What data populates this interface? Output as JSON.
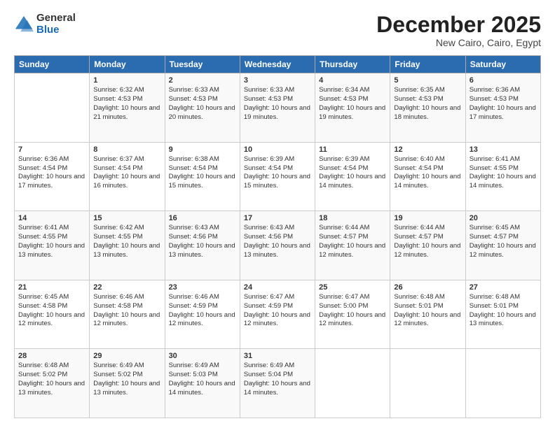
{
  "logo": {
    "general": "General",
    "blue": "Blue"
  },
  "header": {
    "title": "December 2025",
    "subtitle": "New Cairo, Cairo, Egypt"
  },
  "weekdays": [
    "Sunday",
    "Monday",
    "Tuesday",
    "Wednesday",
    "Thursday",
    "Friday",
    "Saturday"
  ],
  "weeks": [
    [
      {
        "day": "",
        "sunrise": "",
        "sunset": "",
        "daylight": ""
      },
      {
        "day": "1",
        "sunrise": "Sunrise: 6:32 AM",
        "sunset": "Sunset: 4:53 PM",
        "daylight": "Daylight: 10 hours and 21 minutes."
      },
      {
        "day": "2",
        "sunrise": "Sunrise: 6:33 AM",
        "sunset": "Sunset: 4:53 PM",
        "daylight": "Daylight: 10 hours and 20 minutes."
      },
      {
        "day": "3",
        "sunrise": "Sunrise: 6:33 AM",
        "sunset": "Sunset: 4:53 PM",
        "daylight": "Daylight: 10 hours and 19 minutes."
      },
      {
        "day": "4",
        "sunrise": "Sunrise: 6:34 AM",
        "sunset": "Sunset: 4:53 PM",
        "daylight": "Daylight: 10 hours and 19 minutes."
      },
      {
        "day": "5",
        "sunrise": "Sunrise: 6:35 AM",
        "sunset": "Sunset: 4:53 PM",
        "daylight": "Daylight: 10 hours and 18 minutes."
      },
      {
        "day": "6",
        "sunrise": "Sunrise: 6:36 AM",
        "sunset": "Sunset: 4:53 PM",
        "daylight": "Daylight: 10 hours and 17 minutes."
      }
    ],
    [
      {
        "day": "7",
        "sunrise": "Sunrise: 6:36 AM",
        "sunset": "Sunset: 4:54 PM",
        "daylight": "Daylight: 10 hours and 17 minutes."
      },
      {
        "day": "8",
        "sunrise": "Sunrise: 6:37 AM",
        "sunset": "Sunset: 4:54 PM",
        "daylight": "Daylight: 10 hours and 16 minutes."
      },
      {
        "day": "9",
        "sunrise": "Sunrise: 6:38 AM",
        "sunset": "Sunset: 4:54 PM",
        "daylight": "Daylight: 10 hours and 15 minutes."
      },
      {
        "day": "10",
        "sunrise": "Sunrise: 6:39 AM",
        "sunset": "Sunset: 4:54 PM",
        "daylight": "Daylight: 10 hours and 15 minutes."
      },
      {
        "day": "11",
        "sunrise": "Sunrise: 6:39 AM",
        "sunset": "Sunset: 4:54 PM",
        "daylight": "Daylight: 10 hours and 14 minutes."
      },
      {
        "day": "12",
        "sunrise": "Sunrise: 6:40 AM",
        "sunset": "Sunset: 4:54 PM",
        "daylight": "Daylight: 10 hours and 14 minutes."
      },
      {
        "day": "13",
        "sunrise": "Sunrise: 6:41 AM",
        "sunset": "Sunset: 4:55 PM",
        "daylight": "Daylight: 10 hours and 14 minutes."
      }
    ],
    [
      {
        "day": "14",
        "sunrise": "Sunrise: 6:41 AM",
        "sunset": "Sunset: 4:55 PM",
        "daylight": "Daylight: 10 hours and 13 minutes."
      },
      {
        "day": "15",
        "sunrise": "Sunrise: 6:42 AM",
        "sunset": "Sunset: 4:55 PM",
        "daylight": "Daylight: 10 hours and 13 minutes."
      },
      {
        "day": "16",
        "sunrise": "Sunrise: 6:43 AM",
        "sunset": "Sunset: 4:56 PM",
        "daylight": "Daylight: 10 hours and 13 minutes."
      },
      {
        "day": "17",
        "sunrise": "Sunrise: 6:43 AM",
        "sunset": "Sunset: 4:56 PM",
        "daylight": "Daylight: 10 hours and 13 minutes."
      },
      {
        "day": "18",
        "sunrise": "Sunrise: 6:44 AM",
        "sunset": "Sunset: 4:57 PM",
        "daylight": "Daylight: 10 hours and 12 minutes."
      },
      {
        "day": "19",
        "sunrise": "Sunrise: 6:44 AM",
        "sunset": "Sunset: 4:57 PM",
        "daylight": "Daylight: 10 hours and 12 minutes."
      },
      {
        "day": "20",
        "sunrise": "Sunrise: 6:45 AM",
        "sunset": "Sunset: 4:57 PM",
        "daylight": "Daylight: 10 hours and 12 minutes."
      }
    ],
    [
      {
        "day": "21",
        "sunrise": "Sunrise: 6:45 AM",
        "sunset": "Sunset: 4:58 PM",
        "daylight": "Daylight: 10 hours and 12 minutes."
      },
      {
        "day": "22",
        "sunrise": "Sunrise: 6:46 AM",
        "sunset": "Sunset: 4:58 PM",
        "daylight": "Daylight: 10 hours and 12 minutes."
      },
      {
        "day": "23",
        "sunrise": "Sunrise: 6:46 AM",
        "sunset": "Sunset: 4:59 PM",
        "daylight": "Daylight: 10 hours and 12 minutes."
      },
      {
        "day": "24",
        "sunrise": "Sunrise: 6:47 AM",
        "sunset": "Sunset: 4:59 PM",
        "daylight": "Daylight: 10 hours and 12 minutes."
      },
      {
        "day": "25",
        "sunrise": "Sunrise: 6:47 AM",
        "sunset": "Sunset: 5:00 PM",
        "daylight": "Daylight: 10 hours and 12 minutes."
      },
      {
        "day": "26",
        "sunrise": "Sunrise: 6:48 AM",
        "sunset": "Sunset: 5:01 PM",
        "daylight": "Daylight: 10 hours and 12 minutes."
      },
      {
        "day": "27",
        "sunrise": "Sunrise: 6:48 AM",
        "sunset": "Sunset: 5:01 PM",
        "daylight": "Daylight: 10 hours and 13 minutes."
      }
    ],
    [
      {
        "day": "28",
        "sunrise": "Sunrise: 6:48 AM",
        "sunset": "Sunset: 5:02 PM",
        "daylight": "Daylight: 10 hours and 13 minutes."
      },
      {
        "day": "29",
        "sunrise": "Sunrise: 6:49 AM",
        "sunset": "Sunset: 5:02 PM",
        "daylight": "Daylight: 10 hours and 13 minutes."
      },
      {
        "day": "30",
        "sunrise": "Sunrise: 6:49 AM",
        "sunset": "Sunset: 5:03 PM",
        "daylight": "Daylight: 10 hours and 14 minutes."
      },
      {
        "day": "31",
        "sunrise": "Sunrise: 6:49 AM",
        "sunset": "Sunset: 5:04 PM",
        "daylight": "Daylight: 10 hours and 14 minutes."
      },
      {
        "day": "",
        "sunrise": "",
        "sunset": "",
        "daylight": ""
      },
      {
        "day": "",
        "sunrise": "",
        "sunset": "",
        "daylight": ""
      },
      {
        "day": "",
        "sunrise": "",
        "sunset": "",
        "daylight": ""
      }
    ]
  ]
}
